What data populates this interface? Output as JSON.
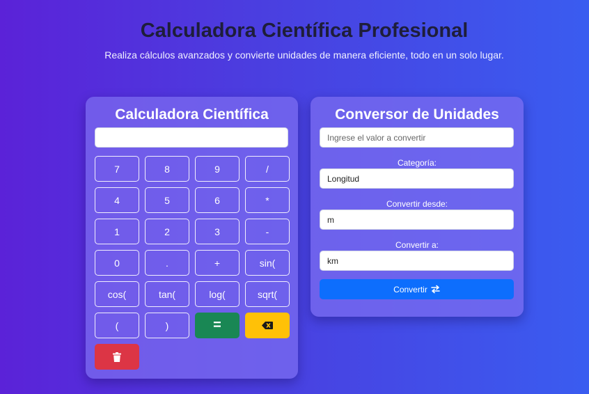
{
  "header": {
    "title": "Calculadora Científica Profesional",
    "subtitle": "Realiza cálculos avanzados y convierte unidades de manera eficiente, todo en un solo lugar."
  },
  "calculator": {
    "title": "Calculadora Científica",
    "display_value": "",
    "keys": [
      "7",
      "8",
      "9",
      "/",
      "4",
      "5",
      "6",
      "*",
      "1",
      "2",
      "3",
      "-",
      "0",
      ".",
      "+",
      "sin(",
      "cos(",
      "tan(",
      "log(",
      "sqrt(",
      "(",
      ")",
      "="
    ],
    "backspace_icon": "backspace-icon",
    "clear_icon": "trash-icon",
    "colors": {
      "equals": "#198754",
      "backspace": "#ffc107",
      "clear": "#dc3545"
    }
  },
  "converter": {
    "title": "Conversor de Unidades",
    "value_placeholder": "Ingrese el valor a convertir",
    "category_label": "Categoría:",
    "category_value": "Longitud",
    "from_label": "Convertir desde:",
    "from_value": "m",
    "to_label": "Convertir a:",
    "to_value": "km",
    "button_label": "Convertir",
    "button_icon": "swap-arrows-icon",
    "button_color": "#0d6efd"
  }
}
